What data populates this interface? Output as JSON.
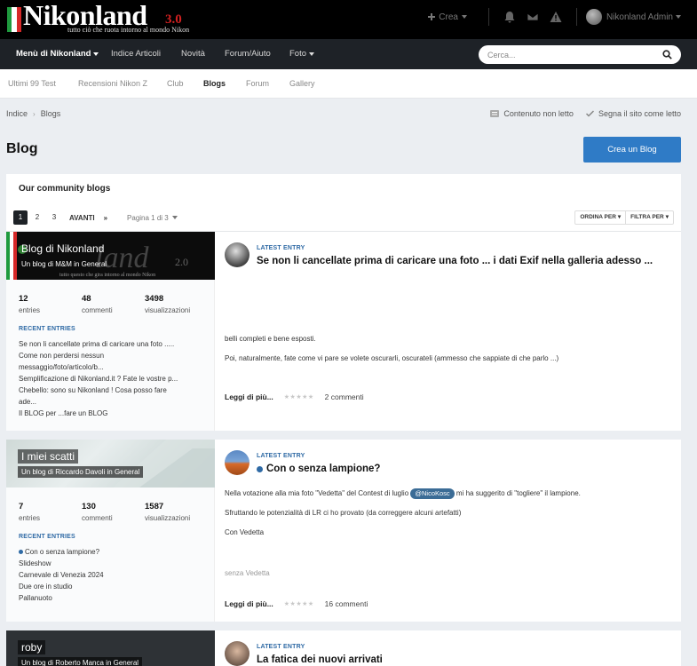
{
  "header": {
    "logo": {
      "word": "Nikonland",
      "version": "3.0",
      "tagline": "tutto ciò che ruota intorno al mondo Nikon"
    },
    "create_label": "Crea",
    "user_name": "Nikonland Admin",
    "icons": [
      "plus-icon",
      "bell-icon",
      "envelope-icon",
      "warning-icon"
    ]
  },
  "nav": {
    "items": [
      "Menù di Nikonland",
      "Indice Articoli",
      "Novità",
      "Forum/Aiuto",
      "Foto"
    ],
    "search_placeholder": "Cerca..."
  },
  "subnav": {
    "items": [
      "Ultimi 99 Test",
      "Recensioni Nikon Z",
      "Club",
      "Blogs",
      "Forum",
      "Gallery"
    ],
    "active": "Blogs"
  },
  "breadcrumb": {
    "items": [
      "Indice",
      "Blogs"
    ]
  },
  "actions": {
    "unread": "Contenuto non letto",
    "mark_read": "Segna il sito come letto"
  },
  "page": {
    "title": "Blog",
    "create_button": "Crea un Blog"
  },
  "container": {
    "title": "Our community blogs",
    "pages": [
      "1",
      "2",
      "3"
    ],
    "current_page": "1",
    "next_label": "AVANTI",
    "last_label": "»",
    "page_info": "Pagina 1 di 3",
    "sort_label": "ORDINA PER",
    "filter_label": "FILTRA PER"
  },
  "labels": {
    "entries": "entries",
    "comments": "commenti",
    "views": "visualizzazioni",
    "recent": "RECENT ENTRIES",
    "latest": "LATEST ENTRY",
    "read_more": "Leggi di più...",
    "stars": "★★★★★"
  },
  "blogs": [
    {
      "title": "Blog di Nikonland",
      "subtitle": "Un blog di M&M in General",
      "entries": "12",
      "comments": "48",
      "views": "3498",
      "recent": [
        "Se non li cancellate prima di caricare una foto .....",
        "Come non perdersi nessun",
        "messaggio/foto/articolo/b...",
        "Semplificazione di Nikonland.it ? Fate le vostre p...",
        "Chebello: sono su Nikonland ! Cosa posso fare",
        "ade...",
        "Il BLOG per ...fare un BLOG"
      ],
      "latest_title": "Se non li cancellate prima di caricare una foto ... i dati Exif nella galleria adesso ...",
      "body": [
        "belli completi e bene esposti.",
        "Poi, naturalmente, fate come vi pare se volete oscurarli, oscurateli (ammesso che sappiate di che parlo ...)"
      ],
      "comments_count": "2 commenti"
    },
    {
      "title": "I miei scatti",
      "subtitle": "Un blog di Riccardo Davoli in General",
      "entries": "7",
      "comments": "130",
      "views": "1587",
      "recent": [
        "Con o senza lampione?",
        "Slideshow",
        "Carnevale di Venezia 2024",
        "Due ore in studio",
        "Pallanuoto"
      ],
      "latest_title": "Con o senza lampione?",
      "body_pre": "Nella votazione alla mia foto \"Vedetta\" del Contest di luglio",
      "mention": "@NicoKosc",
      "body_post": "mi ha suggerito di \"togliere\" il lampione.",
      "body": [
        "Sfruttando le potenzialità di LR ci ho provato (da correggere alcuni artefatti)",
        "Con Vedetta"
      ],
      "caption": "senza Vedetta",
      "comments_count": "16 commenti"
    },
    {
      "title": "roby",
      "subtitle": "Un blog di Roberto Manca in General",
      "latest_title": "La fatica dei nuovi arrivati"
    }
  ],
  "colors": {
    "accent": "#2f7bc6",
    "nav_bg": "#1e2227",
    "header_bg": "#000000",
    "link_blue": "#2f6aa5"
  }
}
